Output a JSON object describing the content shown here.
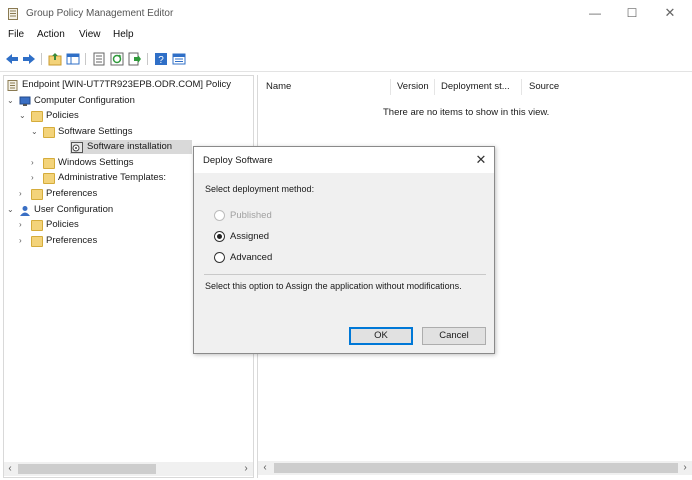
{
  "window": {
    "title": "Group Policy Management Editor"
  },
  "menu": {
    "items": [
      "File",
      "Action",
      "View",
      "Help"
    ]
  },
  "tree": {
    "root": "Endpoint [WIN-UT7TR923EPB.ODR.COM] Policy",
    "computer_config": "Computer Configuration",
    "policies": "Policies",
    "software_settings": "Software Settings",
    "software_installation": "Software installation",
    "windows_settings": "Windows Settings",
    "admin_templates": "Administrative Templates:",
    "preferences": "Preferences",
    "user_config": "User Configuration",
    "user_policies": "Policies",
    "user_preferences": "Preferences"
  },
  "list": {
    "columns": [
      "Name",
      "Version",
      "Deployment st...",
      "Source"
    ],
    "empty_message": "There are no items to show in this view."
  },
  "dialog": {
    "title": "Deploy Software",
    "prompt": "Select deployment method:",
    "options": [
      {
        "label": "Published",
        "enabled": false,
        "selected": false
      },
      {
        "label": "Assigned",
        "enabled": true,
        "selected": true
      },
      {
        "label": "Advanced",
        "enabled": true,
        "selected": false
      }
    ],
    "description": "Select this option to Assign the application without modifications.",
    "ok_label": "OK",
    "cancel_label": "Cancel"
  },
  "colors": {
    "accent": "#0078d7",
    "folder": "#f3d37a",
    "selection": "#d9d9d9"
  },
  "icons": [
    "app-icon",
    "back-icon",
    "forward-icon",
    "up-folder-icon",
    "show-hide-tree-icon",
    "properties-icon",
    "refresh-icon",
    "export-icon",
    "help-icon",
    "view-icon"
  ]
}
